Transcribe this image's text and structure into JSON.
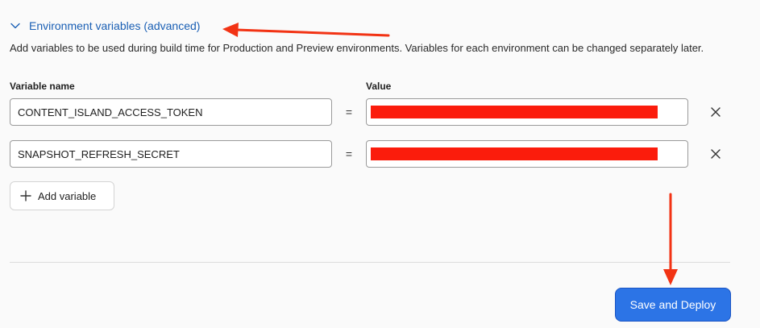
{
  "section": {
    "title": "Environment variables (advanced)",
    "description": "Add variables to be used during build time for Production and Preview environments. Variables for each environment can be changed separately later."
  },
  "columns": {
    "name": "Variable name",
    "value": "Value"
  },
  "variables": [
    {
      "name": "CONTENT_ISLAND_ACCESS_TOKEN",
      "value_redacted": true
    },
    {
      "name": "SNAPSHOT_REFRESH_SECRET",
      "value_redacted": true
    }
  ],
  "equals_symbol": "=",
  "add_variable_label": "Add variable",
  "deploy_label": "Save and Deploy",
  "icons": {
    "toggle": "chevron-down-icon",
    "remove": "close-icon",
    "add": "plus-icon"
  },
  "colors": {
    "accent": "#1a5fb4",
    "primary_button": "#2c74e6",
    "annotation_red": "#f23314",
    "redaction_red": "#fb1c0c"
  }
}
